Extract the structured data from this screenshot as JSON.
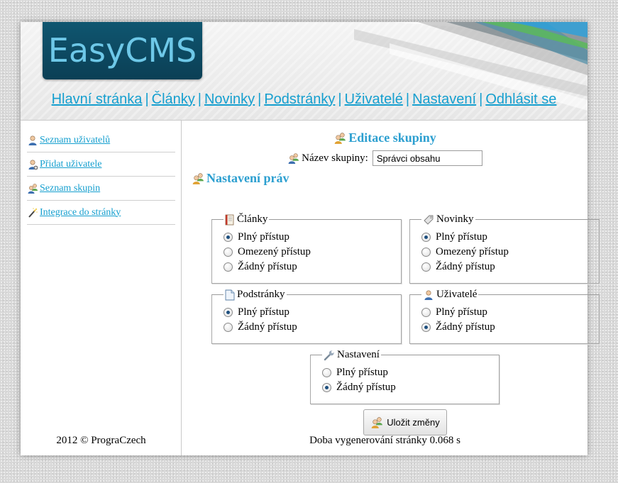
{
  "header": {
    "logo_text": "EasyCMS",
    "nav": [
      {
        "label": "Hlavní stránka"
      },
      {
        "label": "Články"
      },
      {
        "label": "Novinky"
      },
      {
        "label": "Podstránky"
      },
      {
        "label": "Uživatelé"
      },
      {
        "label": "Nastavení"
      },
      {
        "label": "Odhlásit se"
      }
    ],
    "nav_separator": "|"
  },
  "sidebar": {
    "items": [
      {
        "label": " Seznam uživatelů",
        "icon": "user-icon"
      },
      {
        "label": " Přidat uživatele",
        "icon": "add-user-icon"
      },
      {
        "label": " Seznam skupin",
        "icon": "group-icon"
      },
      {
        "label": " Integrace do stránky",
        "icon": "magic-wand-icon"
      }
    ],
    "footer": "2012 © PrograCzech"
  },
  "main": {
    "title": "Editace skupiny",
    "group_name_label": "Název skupiny:",
    "group_name_value": "Správci obsahu",
    "rights_title": "Nastavení práv",
    "sections": {
      "clanky": {
        "legend": "Články",
        "options": [
          {
            "label": "Plný přístup",
            "checked": true
          },
          {
            "label": "Omezený přístup",
            "checked": false
          },
          {
            "label": "Žádný přístup",
            "checked": false
          }
        ]
      },
      "novinky": {
        "legend": "Novinky",
        "options": [
          {
            "label": "Plný přístup",
            "checked": true
          },
          {
            "label": "Omezený přístup",
            "checked": false
          },
          {
            "label": "Žádný přístup",
            "checked": false
          }
        ]
      },
      "podstranky": {
        "legend": "Podstránky",
        "options": [
          {
            "label": "Plný přístup",
            "checked": true
          },
          {
            "label": "Žádný přístup",
            "checked": false
          }
        ]
      },
      "uzivatele": {
        "legend": "Uživatelé",
        "options": [
          {
            "label": "Plný přístup",
            "checked": false
          },
          {
            "label": "Žádný přístup",
            "checked": true
          }
        ]
      },
      "nastaveni": {
        "legend": "Nastavení",
        "options": [
          {
            "label": "Plný přístup",
            "checked": false
          },
          {
            "label": "Žádný přístup",
            "checked": true
          }
        ]
      }
    },
    "save_label": "Uložit změny",
    "footer": "Doba vygenerování stránky 0.068 s"
  },
  "colors": {
    "link": "#159fcf",
    "heading": "#2c9fd0",
    "logo_bg": "#0f5670",
    "logo_text": "#6ec8e8"
  }
}
